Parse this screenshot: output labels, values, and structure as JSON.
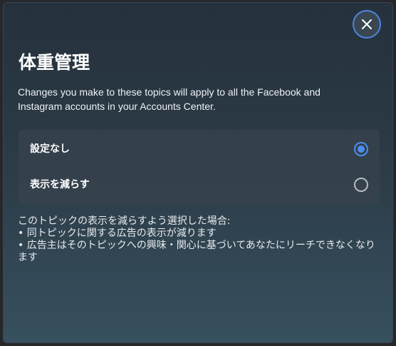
{
  "dialog": {
    "title": "体重管理",
    "description": "Changes you make to these topics will apply to all the Facebook and Instagram accounts in your Accounts Center.",
    "close_icon": "close-icon",
    "options": [
      {
        "label": "設定なし",
        "selected": true
      },
      {
        "label": "表示を減らす",
        "selected": false
      }
    ],
    "info": {
      "intro": "このトピックの表示を減らすよう選択した場合:",
      "bullets": [
        "• 同トピックに関する広告の表示が減ります",
        "• 広告主はそのトピックへの興味・関心に基づいてあなたにリーチできなくなります"
      ]
    }
  },
  "colors": {
    "accent": "#4a8ff0",
    "dialog_bg_top": "#25313c",
    "dialog_bg_bottom": "#37505e"
  }
}
